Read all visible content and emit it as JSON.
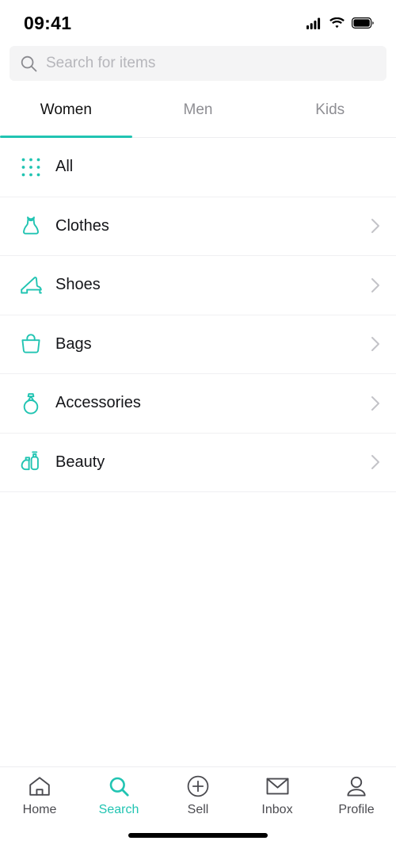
{
  "theme": {
    "accent": "#21c4b2",
    "text_primary": "#15161a",
    "text_muted": "#8e8e93",
    "divider": "#f0f0f2",
    "search_bg": "#f4f4f5"
  },
  "status_bar": {
    "time": "09:41",
    "icons": [
      "cellular-signal-icon",
      "wifi-icon",
      "battery-icon"
    ]
  },
  "search": {
    "placeholder": "Search for items",
    "value": "",
    "icon": "search-icon"
  },
  "tabs": {
    "active_index": 0,
    "items": [
      {
        "label": "Women"
      },
      {
        "label": "Men"
      },
      {
        "label": "Kids"
      }
    ]
  },
  "categories": {
    "items": [
      {
        "label": "All",
        "icon": "grid-dots-icon",
        "chevron": false
      },
      {
        "label": "Clothes",
        "icon": "dress-icon",
        "chevron": true
      },
      {
        "label": "Shoes",
        "icon": "high-heel-icon",
        "chevron": true
      },
      {
        "label": "Bags",
        "icon": "handbag-icon",
        "chevron": true
      },
      {
        "label": "Accessories",
        "icon": "ring-icon",
        "chevron": true
      },
      {
        "label": "Beauty",
        "icon": "perfume-icon",
        "chevron": true
      }
    ]
  },
  "bottom_nav": {
    "active_index": 1,
    "items": [
      {
        "label": "Home",
        "icon": "home-icon"
      },
      {
        "label": "Search",
        "icon": "search-icon"
      },
      {
        "label": "Sell",
        "icon": "plus-circle-icon"
      },
      {
        "label": "Inbox",
        "icon": "envelope-icon"
      },
      {
        "label": "Profile",
        "icon": "person-icon"
      }
    ]
  }
}
